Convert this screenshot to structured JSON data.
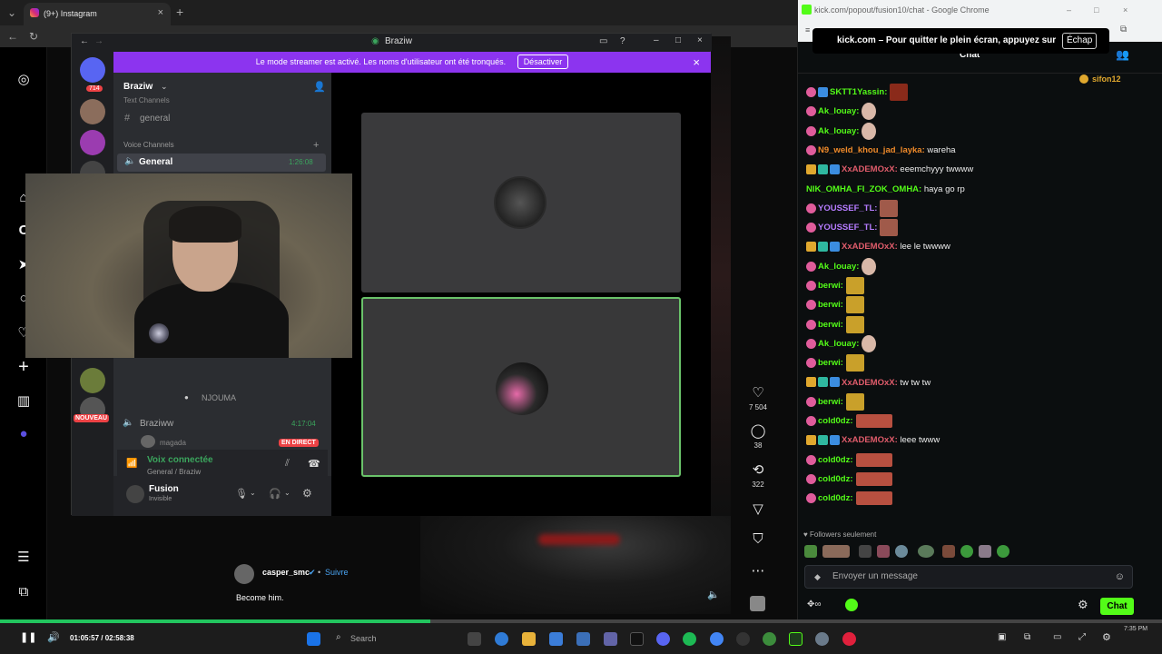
{
  "browser": {
    "tab_title": "(9+) Instagram",
    "new_tab_glyph": "+",
    "close_glyph": "×"
  },
  "instagram": {
    "rail_icons": [
      "instagram-logo-icon",
      "home-icon",
      "reels-icon",
      "explore-icon",
      "search-icon",
      "heart-icon",
      "create-icon",
      "dashboard-icon",
      "profile-icon",
      "menu-icon",
      "meta-icon"
    ],
    "post": {
      "author": "casper_smc",
      "follow": "Suivre",
      "caption": "Become him.",
      "likes": "7 504",
      "comments": "38",
      "reposts": "322"
    }
  },
  "discord": {
    "title": "Braziw",
    "banner_text": "Le mode streamer est activé. Les noms d'utilisateur ont été tronqués.",
    "banner_button": "Désactiver",
    "server_badge": "714",
    "server_name": "Braziw",
    "text_channels_label": "Text Channels",
    "channel_general_text": "general",
    "voice_channels_label": "Voice Channels",
    "voice_general": "General",
    "voice_general_time": "1:26:08",
    "member_njouma": "NJOUMA",
    "new_badge": "NOUVEAU",
    "braziww_channel": "Braziww",
    "braziww_time": "4:17:04",
    "member_magada": "magada",
    "live_badge": "EN DIRECT",
    "voice_connected": "Voix connectée",
    "voice_location": "General / Braziw",
    "user_name": "Fusion",
    "user_status": "Invisible"
  },
  "kick": {
    "window_title": "kick.com/popout/fusion10/chat - Google Chrome",
    "fullscreen_toast": "kick.com – Pour quitter le plein écran, appuyez sur",
    "fullscreen_key": "Échap",
    "chat_header": "Chat",
    "pinned_user": "sifon12",
    "followers_only": "Followers seulement",
    "input_placeholder": "Envoyer un message",
    "chat_button": "Chat",
    "messages": [
      {
        "user": "SKTT1Yassin",
        "text": "",
        "color": "#53fc18",
        "emote": "red",
        "badges": "pink,blue"
      },
      {
        "user": "Ak_louay",
        "text": "",
        "color": "#53fc18",
        "emote": "face",
        "badges": "pink"
      },
      {
        "user": "Ak_louay",
        "text": "",
        "color": "#53fc18",
        "emote": "face",
        "badges": "pink"
      },
      {
        "user": "N9_weld_khou_jad_layka",
        "text": "wareha",
        "color": "#ef8a2a",
        "emote": "",
        "badges": "pink"
      },
      {
        "user": "XxADEMOxX",
        "text": "eeemchyyy twwww",
        "color": "#e05c6b",
        "emote": "",
        "badges": "crown,green,blue"
      },
      {
        "user": "NIK_OMHA_FI_ZOK_OMHA",
        "text": "haya go rp",
        "color": "#53fc18",
        "emote": "",
        "badges": ""
      },
      {
        "user": "YOUSSEF_TL",
        "text": "",
        "color": "#b67cff",
        "emote": "tall",
        "badges": "pink"
      },
      {
        "user": "YOUSSEF_TL",
        "text": "",
        "color": "#b67cff",
        "emote": "tall",
        "badges": "pink"
      },
      {
        "user": "XxADEMOxX",
        "text": "lee le twwww",
        "color": "#e05c6b",
        "emote": "",
        "badges": "crown,green,blue"
      },
      {
        "user": "Ak_louay",
        "text": "",
        "color": "#53fc18",
        "emote": "face",
        "badges": "pink"
      },
      {
        "user": "berwi",
        "text": "",
        "color": "#53fc18",
        "emote": "gold",
        "badges": "pink"
      },
      {
        "user": "berwi",
        "text": "",
        "color": "#53fc18",
        "emote": "gold",
        "badges": "pink"
      },
      {
        "user": "berwi",
        "text": "",
        "color": "#53fc18",
        "emote": "gold",
        "badges": "pink"
      },
      {
        "user": "Ak_louay",
        "text": "",
        "color": "#53fc18",
        "emote": "face",
        "badges": "pink"
      },
      {
        "user": "berwi",
        "text": "",
        "color": "#53fc18",
        "emote": "gold",
        "badges": "pink"
      },
      {
        "user": "XxADEMOxX",
        "text": "tw tw tw",
        "color": "#e05c6b",
        "emote": "",
        "badges": "crown,green,blue"
      },
      {
        "user": "berwi",
        "text": "",
        "color": "#53fc18",
        "emote": "gold",
        "badges": "pink"
      },
      {
        "user": "cold0dz",
        "text": "",
        "color": "#53fc18",
        "emote": "lips",
        "badges": "pink"
      },
      {
        "user": "XxADEMOxX",
        "text": "leee twww",
        "color": "#e05c6b",
        "emote": "",
        "badges": "crown,green,blue"
      },
      {
        "user": "cold0dz",
        "text": "",
        "color": "#53fc18",
        "emote": "lips",
        "badges": "pink"
      },
      {
        "user": "cold0dz",
        "text": "",
        "color": "#53fc18",
        "emote": "lips",
        "badges": "pink"
      },
      {
        "user": "cold0dz",
        "text": "",
        "color": "#53fc18",
        "emote": "lips",
        "badges": "pink"
      }
    ]
  },
  "player": {
    "time": "01:05:57 / 02:58:38",
    "progress": 0.37
  },
  "taskbar": {
    "search_placeholder": "Search",
    "clock": "7:35 PM"
  },
  "colors": {
    "kick_green": "#53fc18",
    "discord_purple": "#8c34ef",
    "live_red": "#ed4245"
  }
}
